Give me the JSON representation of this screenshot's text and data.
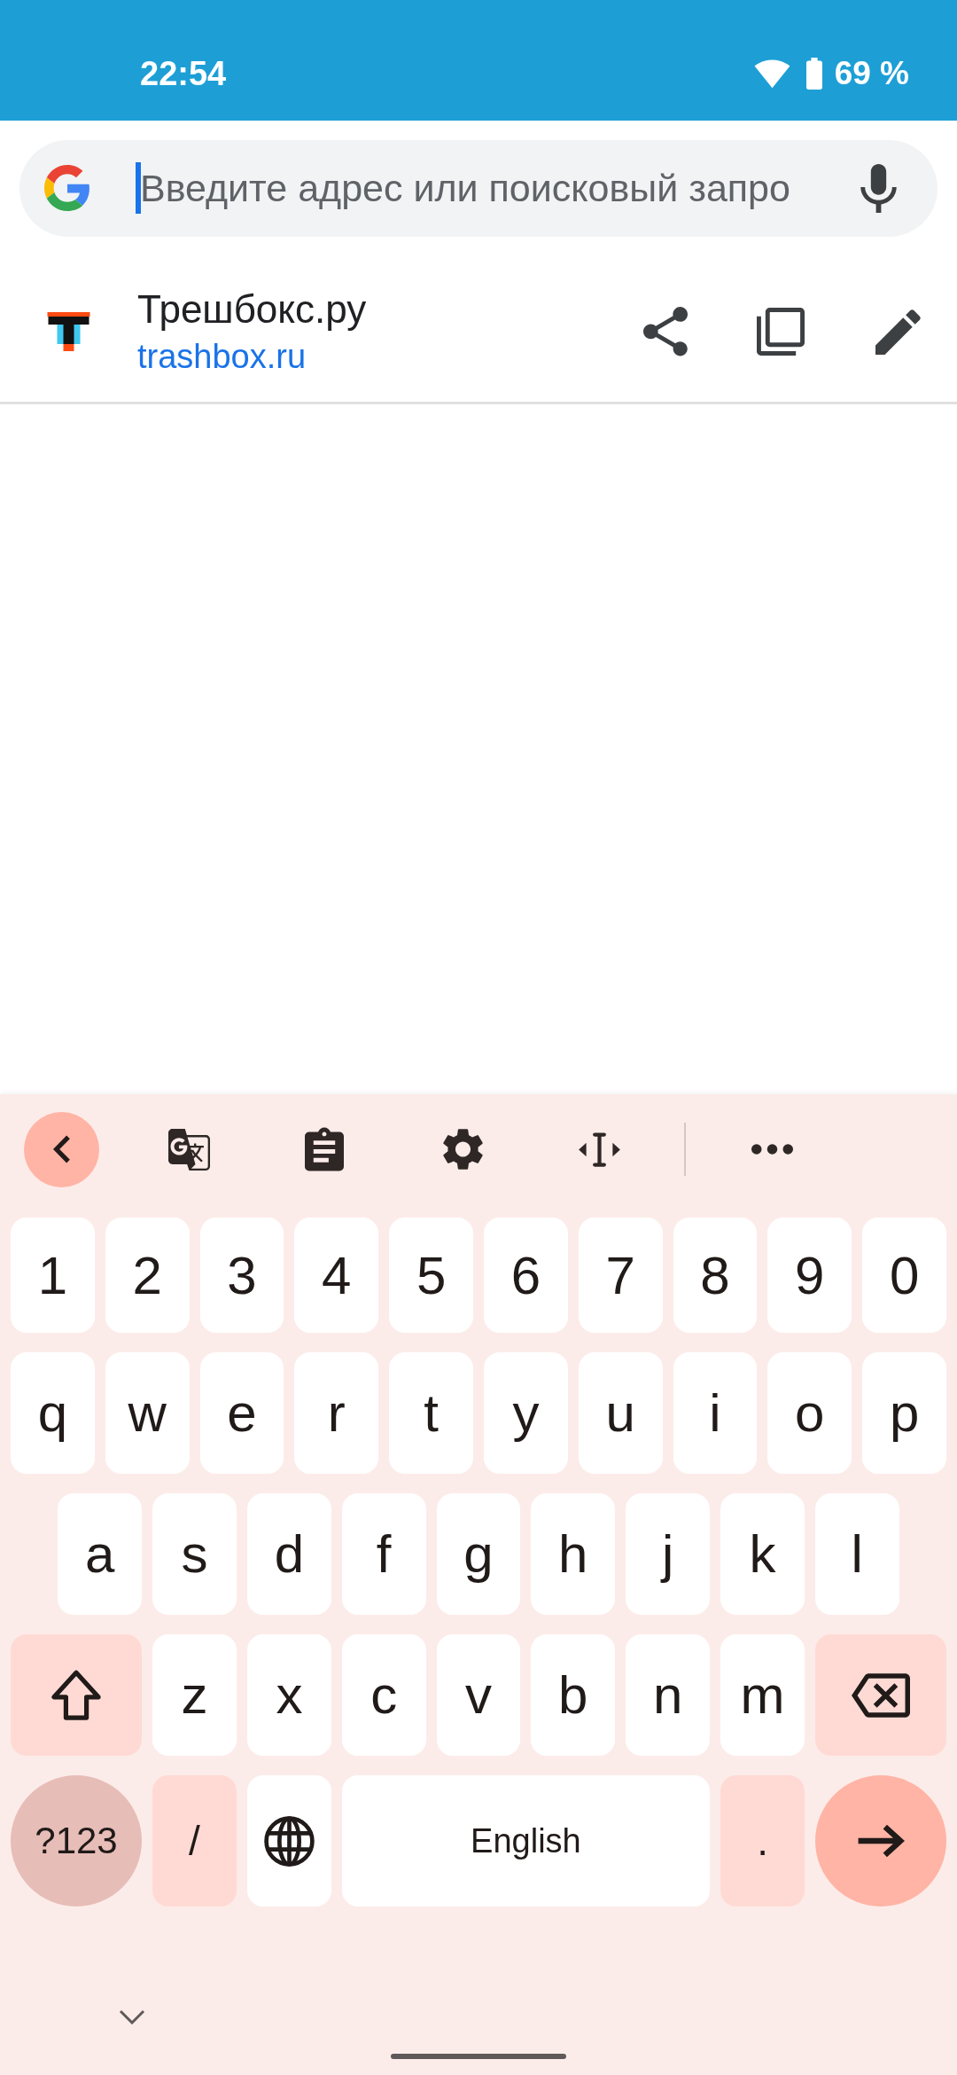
{
  "status_bar": {
    "time": "22:54",
    "battery": "69 %"
  },
  "search": {
    "placeholder": "Введите адрес или поисковый запро",
    "focused": true
  },
  "current_page": {
    "title": "Трешбокс.ру",
    "url": "trashbox.ru"
  },
  "keyboard": {
    "rows": [
      {
        "keys": [
          {
            "kind": "char",
            "label": "1"
          },
          {
            "kind": "char",
            "label": "2"
          },
          {
            "kind": "char",
            "label": "3"
          },
          {
            "kind": "char",
            "label": "4"
          },
          {
            "kind": "char",
            "label": "5"
          },
          {
            "kind": "char",
            "label": "6"
          },
          {
            "kind": "char",
            "label": "7"
          },
          {
            "kind": "char",
            "label": "8"
          },
          {
            "kind": "char",
            "label": "9"
          },
          {
            "kind": "char",
            "label": "0"
          }
        ]
      },
      {
        "keys": [
          {
            "kind": "char",
            "label": "q"
          },
          {
            "kind": "char",
            "label": "w"
          },
          {
            "kind": "char",
            "label": "e"
          },
          {
            "kind": "char",
            "label": "r"
          },
          {
            "kind": "char",
            "label": "t"
          },
          {
            "kind": "char",
            "label": "y"
          },
          {
            "kind": "char",
            "label": "u"
          },
          {
            "kind": "char",
            "label": "i"
          },
          {
            "kind": "char",
            "label": "o"
          },
          {
            "kind": "char",
            "label": "p"
          }
        ]
      },
      {
        "keys": [
          {
            "kind": "char",
            "label": "a"
          },
          {
            "kind": "char",
            "label": "s"
          },
          {
            "kind": "char",
            "label": "d"
          },
          {
            "kind": "char",
            "label": "f"
          },
          {
            "kind": "char",
            "label": "g"
          },
          {
            "kind": "char",
            "label": "h"
          },
          {
            "kind": "char",
            "label": "j"
          },
          {
            "kind": "char",
            "label": "k"
          },
          {
            "kind": "char",
            "label": "l"
          }
        ]
      },
      {
        "keys": [
          {
            "kind": "shift"
          },
          {
            "kind": "char",
            "label": "z"
          },
          {
            "kind": "char",
            "label": "x"
          },
          {
            "kind": "char",
            "label": "c"
          },
          {
            "kind": "char",
            "label": "v"
          },
          {
            "kind": "char",
            "label": "b"
          },
          {
            "kind": "char",
            "label": "n"
          },
          {
            "kind": "char",
            "label": "m"
          },
          {
            "kind": "backspace"
          }
        ]
      },
      {
        "keys": [
          {
            "kind": "symbols",
            "label": "?123"
          },
          {
            "kind": "punct",
            "label": "/"
          },
          {
            "kind": "globe"
          },
          {
            "kind": "space",
            "label": "English"
          },
          {
            "kind": "punct",
            "label": "."
          },
          {
            "kind": "enter"
          }
        ]
      }
    ]
  }
}
